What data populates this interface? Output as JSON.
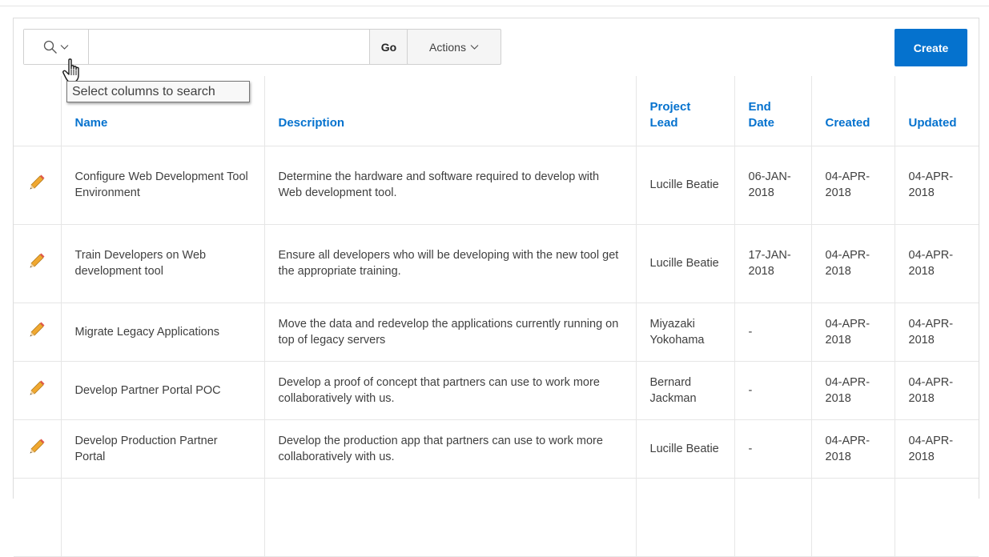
{
  "toolbar": {
    "search_value": "",
    "go_label": "Go",
    "actions_label": "Actions",
    "create_label": "Create"
  },
  "tooltip": "Select columns to search",
  "columns": [
    "Name",
    "Description",
    "Project Lead",
    "End Date",
    "Created",
    "Updated"
  ],
  "rows": [
    {
      "name": "Configure Web Development Tool Environment",
      "description": "Determine the hardware and software required to develop with Web development tool.",
      "lead": "Lucille Beatie",
      "end_date": "06-JAN-2018",
      "created": "04-APR-2018",
      "updated": "04-APR-2018"
    },
    {
      "name": "Train Developers on Web development tool",
      "description": "Ensure all developers who will be developing with the new tool get the appropriate training.",
      "lead": "Lucille Beatie",
      "end_date": "17-JAN-2018",
      "created": "04-APR-2018",
      "updated": "04-APR-2018"
    },
    {
      "name": "Migrate Legacy Applications",
      "description": "Move the data and redevelop the applications currently running on top of legacy servers",
      "lead": "Miyazaki Yokohama",
      "end_date": "-",
      "created": "04-APR-2018",
      "updated": "04-APR-2018"
    },
    {
      "name": "Develop Partner Portal POC",
      "description": "Develop a proof of concept that partners can use to work more collaboratively with us.",
      "lead": "Bernard Jackman",
      "end_date": "-",
      "created": "04-APR-2018",
      "updated": "04-APR-2018"
    },
    {
      "name": "Develop Production Partner Portal",
      "description": "Develop the production app that partners can use to work more collaboratively with us.",
      "lead": "Lucille Beatie",
      "end_date": "-",
      "created": "04-APR-2018",
      "updated": "04-APR-2018"
    }
  ],
  "colors": {
    "accent": "#0572ce",
    "text": "#404040",
    "border": "#e6e6e6",
    "pencil": "#f0a830"
  },
  "icons": {
    "column_search": "search-icon",
    "dropdown": "chevron-down-icon",
    "row_edit": "pencil-icon",
    "pointer": "hand-cursor-icon"
  }
}
